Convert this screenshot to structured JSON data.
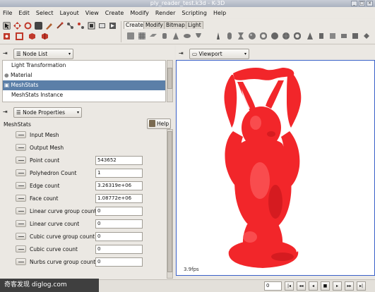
{
  "window": {
    "title": "ply_reader_test.k3d - K-3D",
    "controls": [
      "_",
      "□",
      "×"
    ]
  },
  "menu": [
    "File",
    "Edit",
    "Select",
    "Layout",
    "View",
    "Create",
    "Modify",
    "Render",
    "Scripting",
    "Help"
  ],
  "toolbar": {
    "tabs": [
      "Create",
      "Modify",
      "Bitmap",
      "Light"
    ],
    "active_tab": "Create"
  },
  "node_list": {
    "panel_label": "Node List",
    "items": [
      "Light Transformation",
      "Material",
      "MeshStats",
      "MeshStats Instance"
    ],
    "selected": "MeshStats"
  },
  "node_properties": {
    "panel_label": "Node Properties",
    "node_name": "MeshStats",
    "help_label": "Help",
    "properties": [
      {
        "label": "Input Mesh",
        "value": null
      },
      {
        "label": "Output Mesh",
        "value": null
      },
      {
        "label": "Point count",
        "value": "543652"
      },
      {
        "label": "Polyhedron Count",
        "value": "1"
      },
      {
        "label": "Edge count",
        "value": "3.26319e+06"
      },
      {
        "label": "Face count",
        "value": "1.08772e+06"
      },
      {
        "label": "Linear curve group count",
        "value": "0"
      },
      {
        "label": "Linear curve count",
        "value": "0"
      },
      {
        "label": "Cubic curve group count",
        "value": "0"
      },
      {
        "label": "Cubic curve count",
        "value": "0"
      },
      {
        "label": "Nurbs curve group count",
        "value": "0"
      }
    ]
  },
  "viewport": {
    "panel_label": "Viewport",
    "fps": "3.9fps",
    "model_color": "#f2262a",
    "border_color": "#3a61c8"
  },
  "playback": {
    "frame": "0",
    "buttons": [
      "|◂",
      "◂◂",
      "◂",
      "■",
      "▸",
      "▸▸",
      "▸|"
    ]
  },
  "watermark": "奇客发现 diglog.com"
}
